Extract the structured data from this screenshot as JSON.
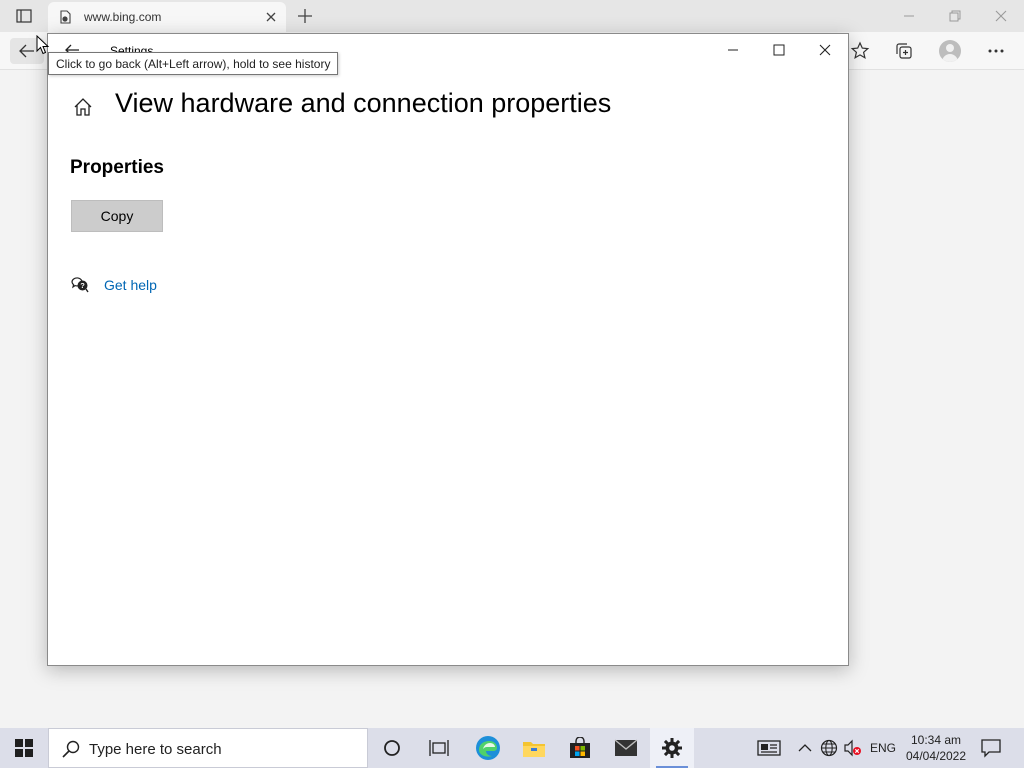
{
  "browser": {
    "tab_title": "www.bing.com"
  },
  "settings": {
    "app_title": "Settings",
    "page_title": "View hardware and connection properties",
    "section_title": "Properties",
    "copy_label": "Copy",
    "help_link": "Get help"
  },
  "tooltip": {
    "text": "Click to go back (Alt+Left arrow), hold to see history"
  },
  "taskbar": {
    "search_placeholder": "Type here to search",
    "language": "ENG",
    "time": "10:34 am",
    "date": "04/04/2022",
    "accent_color": "#6a8fd8"
  },
  "colors": {
    "link": "#0066b4",
    "button_bg": "#cccccc",
    "taskbar_bg": "#dcdee9"
  }
}
